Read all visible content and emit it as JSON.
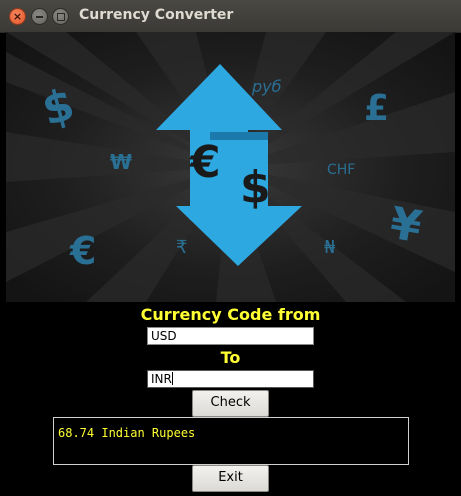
{
  "window": {
    "title": "Currency Converter"
  },
  "banner": {
    "symbols": [
      "$",
      "руб",
      "£",
      "₩",
      "CHF",
      "€",
      "₹",
      "₦",
      "¥"
    ],
    "center_euro": "€",
    "center_dollar": "$",
    "colors": {
      "icon_blue": "#2ea8e0",
      "symbol_blue": "#2a6f94",
      "bg_dark": "#1c1c1c"
    }
  },
  "form": {
    "from_label": "Currency Code from",
    "from_value": "USD",
    "to_label": "To",
    "to_value": "INR",
    "check_button": "Check",
    "result": "68.74 Indian Rupees",
    "exit_button": "Exit",
    "label_color": "#ffff33"
  }
}
